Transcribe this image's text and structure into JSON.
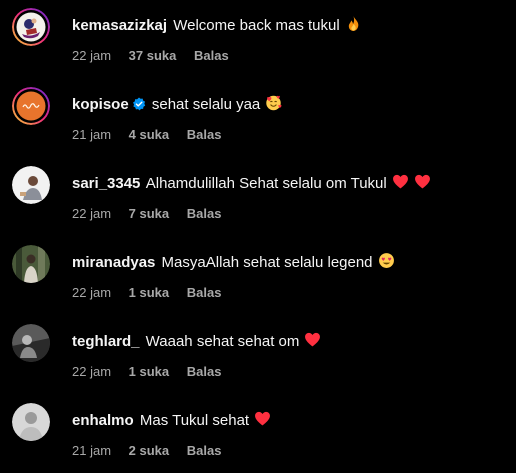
{
  "comments": [
    {
      "username": "kemasazizkaj",
      "verified": false,
      "text": "Welcome back mas tukul",
      "emojis": [
        "fire-emoji"
      ],
      "time": "22 jam",
      "likes": "37 suka",
      "reply": "Balas",
      "avatar_icon": "avatar-cartoon-icon",
      "ring": true
    },
    {
      "username": "kopisoe",
      "verified": true,
      "text": "sehat selalu yaa",
      "emojis": [
        "smiling-face-with-hearts-emoji"
      ],
      "time": "21 jam",
      "likes": "4 suka",
      "reply": "Balas",
      "avatar_icon": "avatar-kopisoe-logo-icon",
      "ring": true
    },
    {
      "username": "sari_3345",
      "verified": false,
      "text": "Alhamdulillah Sehat selalu om Tukul",
      "emojis": [
        "red-heart-emoji",
        "red-heart-emoji"
      ],
      "time": "22 jam",
      "likes": "7 suka",
      "reply": "Balas",
      "avatar_icon": "avatar-photo-icon",
      "ring": false
    },
    {
      "username": "miranadyas",
      "verified": false,
      "text": "MasyaAllah sehat selalu legend",
      "emojis": [
        "heart-eyes-emoji"
      ],
      "time": "22 jam",
      "likes": "1 suka",
      "reply": "Balas",
      "avatar_icon": "avatar-photo-icon",
      "ring": false
    },
    {
      "username": "teghlard_",
      "verified": false,
      "text": "Waaah sehat sehat om",
      "emojis": [
        "red-heart-emoji"
      ],
      "time": "22 jam",
      "likes": "1 suka",
      "reply": "Balas",
      "avatar_icon": "avatar-photo-icon",
      "ring": false
    },
    {
      "username": "enhalmo",
      "verified": false,
      "text": "Mas Tukul sehat",
      "emojis": [
        "red-heart-emoji"
      ],
      "time": "21 jam",
      "likes": "2 suka",
      "reply": "Balas",
      "avatar_icon": "avatar-photo-icon",
      "ring": false
    }
  ],
  "colors": {
    "background": "#000000",
    "text": "#f5f5f5",
    "meta": "#a8a8a8",
    "verified": "#0095f6",
    "heart": "#ff3040",
    "story_ring_start": "#f9ce34",
    "story_ring_mid": "#ee2a7b",
    "story_ring_end": "#6228d7"
  }
}
